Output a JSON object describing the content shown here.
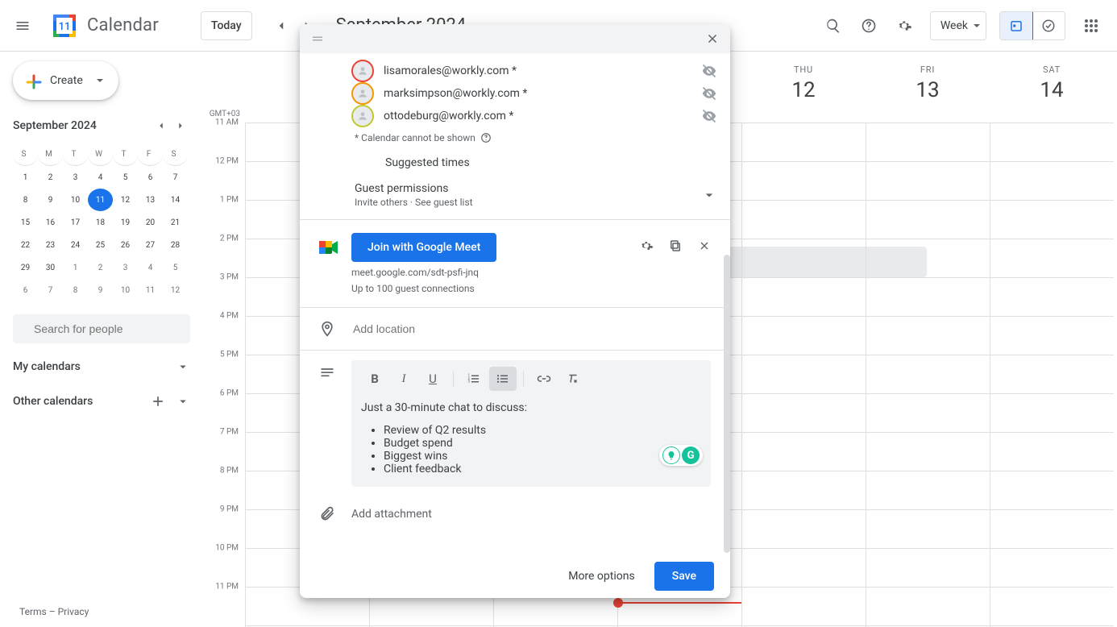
{
  "header": {
    "product": "Calendar",
    "today_btn": "Today",
    "month_title": "September 2024",
    "view_label": "Week"
  },
  "sidebar": {
    "create_label": "Create",
    "mini_title": "September 2024",
    "dow": [
      "S",
      "M",
      "T",
      "W",
      "T",
      "F",
      "S"
    ],
    "weeks": [
      [
        {
          "d": "1"
        },
        {
          "d": "2"
        },
        {
          "d": "3"
        },
        {
          "d": "4"
        },
        {
          "d": "5"
        },
        {
          "d": "6"
        },
        {
          "d": "7"
        }
      ],
      [
        {
          "d": "8"
        },
        {
          "d": "9"
        },
        {
          "d": "10"
        },
        {
          "d": "11",
          "today": true
        },
        {
          "d": "12"
        },
        {
          "d": "13"
        },
        {
          "d": "14"
        }
      ],
      [
        {
          "d": "15"
        },
        {
          "d": "16"
        },
        {
          "d": "17"
        },
        {
          "d": "18"
        },
        {
          "d": "19"
        },
        {
          "d": "20"
        },
        {
          "d": "21"
        }
      ],
      [
        {
          "d": "22"
        },
        {
          "d": "23"
        },
        {
          "d": "24"
        },
        {
          "d": "25"
        },
        {
          "d": "26"
        },
        {
          "d": "27"
        },
        {
          "d": "28"
        }
      ],
      [
        {
          "d": "29"
        },
        {
          "d": "30"
        },
        {
          "d": "1",
          "o": true
        },
        {
          "d": "2",
          "o": true
        },
        {
          "d": "3",
          "o": true
        },
        {
          "d": "4",
          "o": true
        },
        {
          "d": "5",
          "o": true
        }
      ],
      [
        {
          "d": "6",
          "o": true
        },
        {
          "d": "7",
          "o": true
        },
        {
          "d": "8",
          "o": true
        },
        {
          "d": "9",
          "o": true
        },
        {
          "d": "10",
          "o": true
        },
        {
          "d": "11",
          "o": true
        },
        {
          "d": "12",
          "o": true
        }
      ]
    ],
    "search_placeholder": "Search for people",
    "my_calendars": "My calendars",
    "other_calendars": "Other calendars"
  },
  "footer": {
    "terms": "Terms",
    "sep": " – ",
    "privacy": "Privacy"
  },
  "grid": {
    "tz": "GMT+03",
    "days": [
      {
        "dow": "",
        "dnum": ""
      },
      {
        "dow": "",
        "dnum": ""
      },
      {
        "dow": "",
        "dnum": ""
      },
      {
        "dow": "",
        "dnum": ""
      },
      {
        "dow": "THU",
        "dnum": "12"
      },
      {
        "dow": "FRI",
        "dnum": "13"
      },
      {
        "dow": "SAT",
        "dnum": "14"
      }
    ],
    "hours": [
      "11 AM",
      "12 PM",
      "1 PM",
      "2 PM",
      "3 PM",
      "4 PM",
      "5 PM",
      "6 PM",
      "7 PM",
      "8 PM",
      "9 PM",
      "10 PM",
      "11 PM"
    ]
  },
  "modal": {
    "guests": [
      {
        "email": "lisamorales@workly.com *",
        "ring": "#ea4335"
      },
      {
        "email": "marksimpson@workly.com *",
        "ring": "#f29900"
      },
      {
        "email": "ottodeburg@workly.com *",
        "ring": "#c0ca33"
      }
    ],
    "cal_note": "* Calendar cannot be shown",
    "suggested": "Suggested times",
    "perm_title": "Guest permissions",
    "perm_sub1": "Invite others",
    "perm_dot": " · ",
    "perm_sub2": "See guest list",
    "join_meet": "Join with Google Meet",
    "meet_link": "meet.google.com/sdt-psfi-jnq",
    "meet_cap": "Up to 100 guest connections",
    "location_ph": "Add location",
    "desc_intro": "Just a 30-minute chat to discuss:",
    "desc_items": [
      "Review of Q2 results",
      "Budget spend",
      "Biggest wins",
      "Client feedback"
    ],
    "attach_ph": "Add attachment",
    "more_options": "More options",
    "save": "Save"
  }
}
